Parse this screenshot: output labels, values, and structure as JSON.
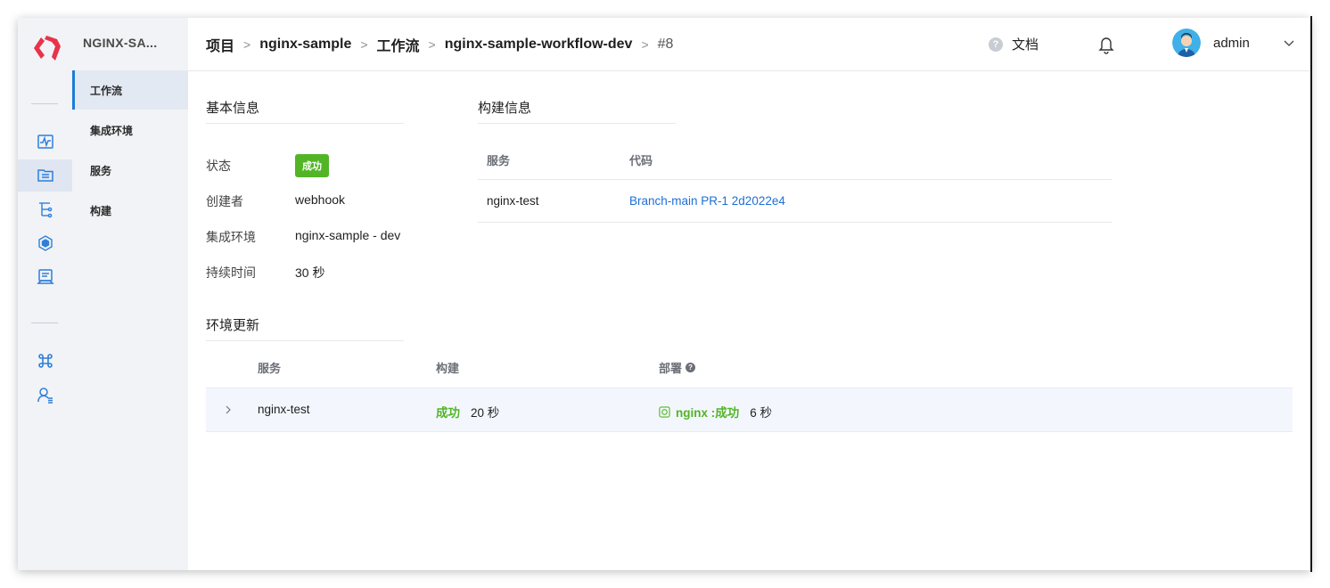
{
  "sidebar_rail": {
    "icons": [
      "activity-icon",
      "list-icon",
      "tree-icon",
      "cube-icon",
      "monitor-icon",
      "command-icon",
      "user-list-icon"
    ]
  },
  "subnav": {
    "project_name": "NGINX-SA...",
    "items": [
      {
        "label": "工作流",
        "active": true
      },
      {
        "label": "集成环境",
        "active": false
      },
      {
        "label": "服务",
        "active": false
      },
      {
        "label": "构建",
        "active": false
      }
    ]
  },
  "header": {
    "breadcrumb": [
      "项目",
      "nginx-sample",
      "工作流",
      "nginx-sample-workflow-dev",
      "#8"
    ],
    "separator": ">",
    "docs_label": "文档",
    "username": "admin"
  },
  "basic_info": {
    "title": "基本信息",
    "status_label": "状态",
    "status_value": "成功",
    "creator_label": "创建者",
    "creator_value": "webhook",
    "env_label": "集成环境",
    "env_value": "nginx-sample - dev",
    "duration_label": "持续时间",
    "duration_value": "30 秒"
  },
  "build_info": {
    "title": "构建信息",
    "col_service": "服务",
    "col_code": "代码",
    "rows": [
      {
        "service": "nginx-test",
        "code": "Branch-main PR-1 2d2022e4"
      }
    ]
  },
  "env_update": {
    "title": "环境更新",
    "col_service": "服务",
    "col_build": "构建",
    "col_deploy": "部署",
    "rows": [
      {
        "service": "nginx-test",
        "build_status": "成功",
        "build_time": "20 秒",
        "deploy_name": "nginx :成功",
        "deploy_time": "6 秒"
      }
    ]
  },
  "colors": {
    "accent": "#1d7bd8",
    "success": "#52b526",
    "link": "#1d6fd6",
    "logo": "#e8334a"
  }
}
